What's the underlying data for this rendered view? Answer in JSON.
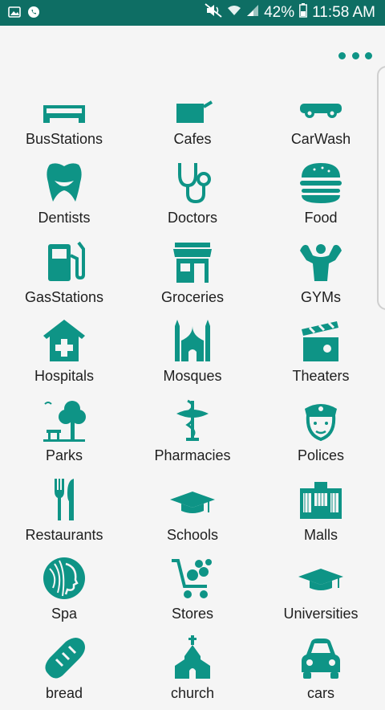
{
  "status_bar": {
    "battery": "42%",
    "time": "11:58 AM"
  },
  "colors": {
    "accent": "#0e9486",
    "status_bar": "#0e6e64"
  },
  "categories": [
    {
      "label": "BusStations",
      "icon": "bus-icon"
    },
    {
      "label": "Cafes",
      "icon": "coffee-cup-icon"
    },
    {
      "label": "CarWash",
      "icon": "car-wash-icon"
    },
    {
      "label": "Dentists",
      "icon": "tooth-icon"
    },
    {
      "label": "Doctors",
      "icon": "stethoscope-icon"
    },
    {
      "label": "Food",
      "icon": "burger-icon"
    },
    {
      "label": "GasStations",
      "icon": "gas-pump-icon"
    },
    {
      "label": "Groceries",
      "icon": "shop-icon"
    },
    {
      "label": "GYMs",
      "icon": "bodybuilder-icon"
    },
    {
      "label": "Hospitals",
      "icon": "hospital-icon"
    },
    {
      "label": "Mosques",
      "icon": "mosque-icon"
    },
    {
      "label": "Theaters",
      "icon": "clapperboard-icon"
    },
    {
      "label": "Parks",
      "icon": "park-tree-icon"
    },
    {
      "label": "Pharmacies",
      "icon": "caduceus-icon"
    },
    {
      "label": "Polices",
      "icon": "police-officer-icon"
    },
    {
      "label": "Restaurants",
      "icon": "fork-knife-icon"
    },
    {
      "label": "Schools",
      "icon": "graduation-cap-icon"
    },
    {
      "label": "Malls",
      "icon": "mall-building-icon"
    },
    {
      "label": "Spa",
      "icon": "spa-face-icon"
    },
    {
      "label": "Stores",
      "icon": "shopping-cart-icon"
    },
    {
      "label": "Universities",
      "icon": "mortarboard-icon"
    },
    {
      "label": "bread",
      "icon": "bread-icon"
    },
    {
      "label": "church",
      "icon": "church-icon"
    },
    {
      "label": "cars",
      "icon": "car-icon"
    }
  ]
}
